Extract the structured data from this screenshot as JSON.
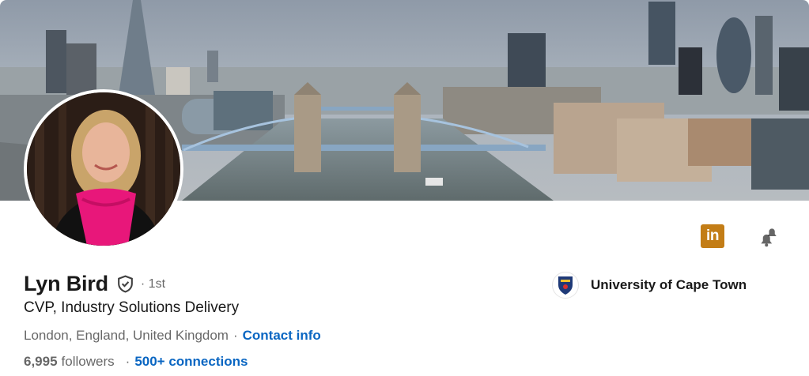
{
  "profile": {
    "name": "Lyn Bird",
    "degree": "· 1st",
    "headline": "CVP, Industry Solutions Delivery",
    "location": "London, England, United Kingdom",
    "separator": "·",
    "contact_info_label": "Contact info",
    "followers_count": "6,995",
    "followers_label": "followers",
    "connections_label": "500+ connections"
  },
  "education": {
    "name": "University of Cape Town",
    "logo_icon": "university-crest-icon"
  },
  "actions": {
    "linkedin_icon_text": "in",
    "linkedin_color": "#c37d16",
    "bell_icon": "bell-icon"
  },
  "colors": {
    "link": "#0a66c2",
    "scarf": "#e8177a"
  },
  "banner": {
    "image": "banner-image-tower-bridge"
  }
}
